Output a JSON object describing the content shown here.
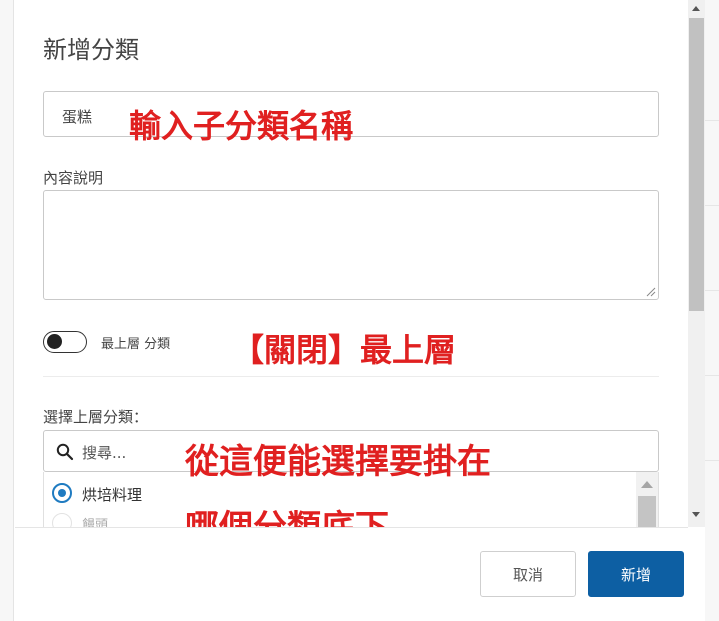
{
  "dialog": {
    "title": "新增分類",
    "name_input": {
      "value": "蛋糕"
    },
    "description": {
      "label": "內容說明",
      "value": ""
    },
    "top_level_toggle": {
      "label": "最上層 分類",
      "on": false
    },
    "parent_category": {
      "label": "選擇上層分類：",
      "search_placeholder": "搜尋...",
      "tree": [
        {
          "label": "烘培料理",
          "selected": true
        },
        {
          "label": "饅頭",
          "selected": false
        }
      ]
    },
    "buttons": {
      "cancel": "取消",
      "submit": "新增"
    }
  },
  "annotations": {
    "name_hint": "輸入子分類名稱",
    "toggle_hint": "【關閉】最上層",
    "parent_hint_line1": "從這便能選擇要掛在",
    "parent_hint_line2": "哪個分類底下"
  },
  "colors": {
    "primary_button": "#0d5fa3",
    "radio_accent": "#1f7bc1",
    "annotation": "#e02020"
  },
  "icons": [
    "search-icon",
    "resize-grip-icon",
    "scroll-up-arrow-icon",
    "scroll-down-arrow-icon"
  ]
}
